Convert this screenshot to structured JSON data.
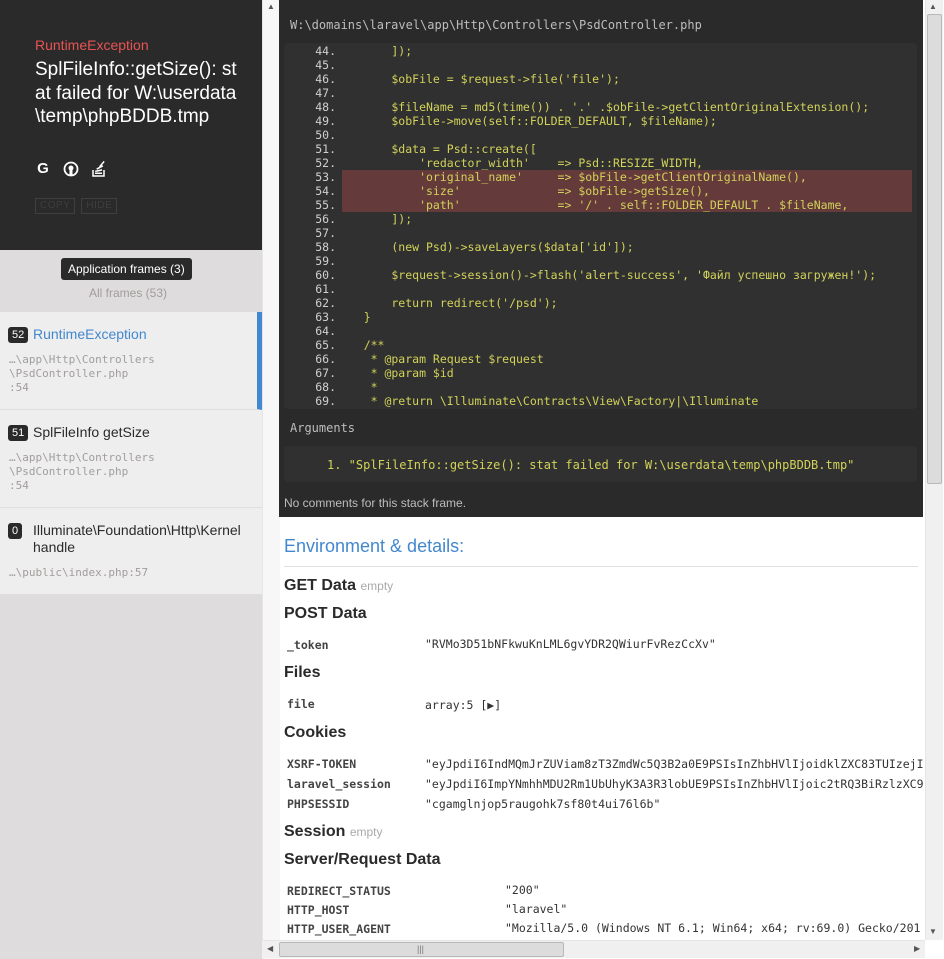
{
  "header": {
    "exception_class": "RuntimeException",
    "exception_message": "SplFileInfo::getSize(): stat failed for W:\\userdata\\temp\\phpBDDB.tmp",
    "icons": [
      "google-icon",
      "duckduckgo-icon",
      "stackoverflow-icon"
    ],
    "copy_label": "COPY",
    "hide_label": "HIDE"
  },
  "frame_toggles": {
    "application_frames": "Application frames (3)",
    "all_frames": "All frames (53)"
  },
  "frames": [
    {
      "number": "52",
      "class": "RuntimeException",
      "path": "…\\app\\Http\\Controllers\n\\PsdController.php\n:54",
      "active": true
    },
    {
      "number": "51",
      "class": "SplFileInfo getSize",
      "path": "…\\app\\Http\\Controllers\n\\PsdController.php\n:54",
      "active": false
    },
    {
      "number": "0",
      "class": "Illuminate\\Foundation\\Http\\Kernel handle",
      "path": "…\\public\\index.php:57",
      "active": false
    }
  ],
  "code": {
    "file_path": "W:\\domains\\laravel\\app\\Http\\Controllers\\PsdController.php",
    "highlight_lines": [
      53,
      54,
      55
    ],
    "lines": [
      {
        "n": "44.",
        "text": "        ]);"
      },
      {
        "n": "45.",
        "text": ""
      },
      {
        "n": "46.",
        "text": "        $obFile = $request->file('file');"
      },
      {
        "n": "47.",
        "text": ""
      },
      {
        "n": "48.",
        "text": "        $fileName = md5(time()) . '.' .$obFile->getClientOriginalExtension();"
      },
      {
        "n": "49.",
        "text": "        $obFile->move(self::FOLDER_DEFAULT, $fileName);"
      },
      {
        "n": "50.",
        "text": ""
      },
      {
        "n": "51.",
        "text": "        $data = Psd::create(["
      },
      {
        "n": "52.",
        "text": "            'redactor_width'    => Psd::RESIZE_WIDTH,"
      },
      {
        "n": "53.",
        "text": "            'original_name'     => $obFile->getClientOriginalName(),"
      },
      {
        "n": "54.",
        "text": "            'size'              => $obFile->getSize(),"
      },
      {
        "n": "55.",
        "text": "            'path'              => '/' . self::FOLDER_DEFAULT . $fileName,"
      },
      {
        "n": "56.",
        "text": "        ]);"
      },
      {
        "n": "57.",
        "text": ""
      },
      {
        "n": "58.",
        "text": "        (new Psd)->saveLayers($data['id']);"
      },
      {
        "n": "59.",
        "text": ""
      },
      {
        "n": "60.",
        "text": "        $request->session()->flash('alert-success', 'Файл успешно загружен!');"
      },
      {
        "n": "61.",
        "text": ""
      },
      {
        "n": "62.",
        "text": "        return redirect('/psd');"
      },
      {
        "n": "63.",
        "text": "    }"
      },
      {
        "n": "64.",
        "text": ""
      },
      {
        "n": "65.",
        "text": "    /**"
      },
      {
        "n": "66.",
        "text": "     * @param Request $request"
      },
      {
        "n": "67.",
        "text": "     * @param $id"
      },
      {
        "n": "68.",
        "text": "     *"
      },
      {
        "n": "69.",
        "text": "     * @return \\Illuminate\\Contracts\\View\\Factory|\\Illuminate"
      }
    ],
    "arguments_label": "Arguments",
    "arguments": [
      "1. \"SplFileInfo::getSize(): stat failed for W:\\userdata\\temp\\phpBDDB.tmp\""
    ],
    "no_comments": "No comments for this stack frame."
  },
  "environment": {
    "title": "Environment & details:",
    "get_data": {
      "label": "GET Data",
      "empty": "empty"
    },
    "post_data": {
      "label": "POST Data",
      "rows": [
        {
          "key": "_token",
          "value": "\"RVMo3D51bNFkwuKnLML6gvYDR2QWiurFvRezCcXv\""
        }
      ]
    },
    "files": {
      "label": "Files",
      "rows": [
        {
          "key": "file",
          "value": "array:5 [▶]"
        }
      ]
    },
    "cookies": {
      "label": "Cookies",
      "rows": [
        {
          "key": "XSRF-TOKEN",
          "value": "\"eyJpdiI6IndMQmJrZUViam8zT3ZmdWc5Q3B2a0E9PSIsInZhbHVlIjoidklZXC83TUIzejI"
        },
        {
          "key": "laravel_session",
          "value": "\"eyJpdiI6ImpYNmhhMDU2Rm1UbUhyK3A3R3lobUE9PSIsInZhbHVlIjoic2tRQ3BiRzlzXC9"
        },
        {
          "key": "PHPSESSID",
          "value": "\"cgamglnjop5raugohk7sf80t4ui76l6b\""
        }
      ]
    },
    "session": {
      "label": "Session",
      "empty": "empty"
    },
    "server": {
      "label": "Server/Request Data",
      "rows": [
        {
          "key": "REDIRECT_STATUS",
          "value": "\"200\""
        },
        {
          "key": "HTTP_HOST",
          "value": "\"laravel\""
        },
        {
          "key": "HTTP_USER_AGENT",
          "value": "\"Mozilla/5.0 (Windows NT 6.1; Win64; x64; rv:69.0) Gecko/201"
        }
      ]
    }
  },
  "scrollbar": {
    "h_thumb_grip": "|||"
  }
}
